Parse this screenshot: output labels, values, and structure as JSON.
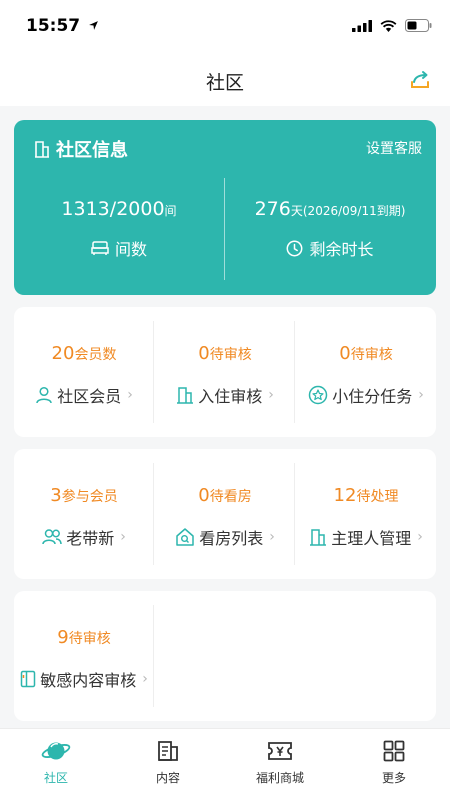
{
  "status": {
    "time": "15:57"
  },
  "header": {
    "title": "社区"
  },
  "info_card": {
    "title": "社区信息",
    "link": "设置客服",
    "rooms": {
      "used": "1313",
      "total": "2000",
      "unit": "间",
      "label": "间数"
    },
    "remain": {
      "days": "276",
      "unit": "天",
      "expiry": "(2026/09/11到期)",
      "label": "剩余时长"
    }
  },
  "cards": [
    {
      "cells": [
        {
          "count": "20",
          "suffix": "会员数",
          "label": "社区会员",
          "icon": "person-icon"
        },
        {
          "count": "0",
          "suffix": "待审核",
          "label": "入住审核",
          "icon": "building-icon"
        },
        {
          "count": "0",
          "suffix": "待审核",
          "label": "小住分任务",
          "icon": "star-badge-icon"
        }
      ]
    },
    {
      "cells": [
        {
          "count": "3",
          "suffix": "参与会员",
          "label": "老带新",
          "icon": "group-icon"
        },
        {
          "count": "0",
          "suffix": "待看房",
          "label": "看房列表",
          "icon": "house-search-icon"
        },
        {
          "count": "12",
          "suffix": "待处理",
          "label": "主理人管理",
          "icon": "building-icon"
        }
      ]
    },
    {
      "cells": [
        {
          "count": "9",
          "suffix": "待审核",
          "label": "敏感内容审核",
          "icon": "document-icon"
        }
      ]
    }
  ],
  "tabs": [
    {
      "label": "社区",
      "icon": "planet-icon",
      "active": true
    },
    {
      "label": "内容",
      "icon": "content-icon",
      "active": false
    },
    {
      "label": "福利商城",
      "icon": "ticket-icon",
      "active": false
    },
    {
      "label": "更多",
      "icon": "grid-icon",
      "active": false
    }
  ],
  "colors": {
    "accent": "#2db6ad",
    "count": "#f08a24",
    "share": "#f5a623"
  }
}
